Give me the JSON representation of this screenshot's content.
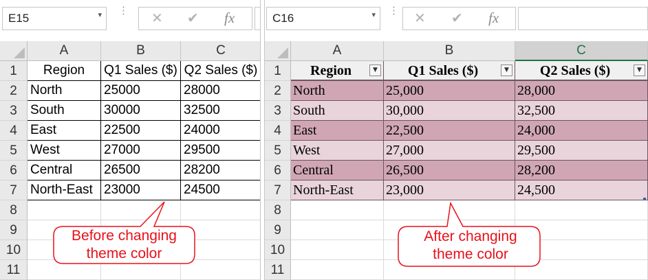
{
  "left_sheet": {
    "name_box": "E15",
    "formula_buttons": [
      "✕",
      "✔",
      "fx"
    ],
    "columns": [
      "A",
      "B",
      "C"
    ],
    "rows": [
      "1",
      "2",
      "3",
      "4",
      "5",
      "6",
      "7",
      "8",
      "9",
      "10",
      "11"
    ],
    "table": {
      "headers": [
        "Region",
        "Q1 Sales ($)",
        "Q2 Sales ($)"
      ],
      "rows": [
        [
          "North",
          "25000",
          "28000"
        ],
        [
          "South",
          "30000",
          "32500"
        ],
        [
          "East",
          "22500",
          "24000"
        ],
        [
          "West",
          "27000",
          "29500"
        ],
        [
          "Central",
          "26500",
          "28200"
        ],
        [
          "North-East",
          "23000",
          "24500"
        ]
      ]
    },
    "callout": [
      "Before changing",
      "theme color"
    ]
  },
  "right_sheet": {
    "name_box": "C16",
    "formula_buttons": [
      "✕",
      "✔",
      "fx"
    ],
    "columns": [
      "A",
      "B",
      "C"
    ],
    "selected_column": "C",
    "rows": [
      "1",
      "2",
      "3",
      "4",
      "5",
      "6",
      "7",
      "8",
      "9",
      "10",
      "11"
    ],
    "table": {
      "headers": [
        "Region",
        "Q1 Sales ($)",
        "Q2 Sales ($)"
      ],
      "filter_icon": "▼",
      "rows": [
        [
          "North",
          "25,000",
          "28,000"
        ],
        [
          "South",
          "30,000",
          "32,500"
        ],
        [
          "East",
          "22,500",
          "24,000"
        ],
        [
          "West",
          "27,000",
          "29,500"
        ],
        [
          "Central",
          "26,500",
          "28,200"
        ],
        [
          "North-East",
          "23,000",
          "24,500"
        ]
      ]
    },
    "callout": [
      "After changing",
      "theme color"
    ]
  },
  "colors": {
    "band_dark": "#d0a6b5",
    "band_light": "#ead4dc",
    "callout_red": "#e8101a",
    "selected_header_green": "#217346"
  },
  "icons": [
    "dropdown-arrow-icon",
    "cancel-icon",
    "enter-icon",
    "insert-function-icon",
    "filter-dropdown-icon"
  ]
}
